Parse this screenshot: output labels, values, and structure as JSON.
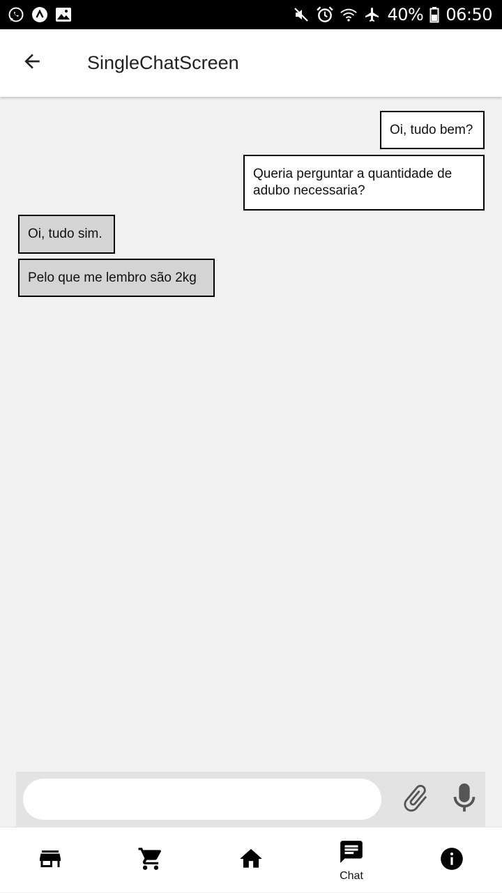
{
  "status_bar": {
    "battery": "40%",
    "time": "06:50",
    "left_icons": [
      "whatsapp-icon",
      "notification-a-icon",
      "image-icon"
    ],
    "right_icons": [
      "mute-icon",
      "alarm-icon",
      "wifi-icon",
      "airplane-icon",
      "battery-icon"
    ]
  },
  "app_bar": {
    "title": "SingleChatScreen",
    "back_icon": "arrow-left-icon"
  },
  "messages": [
    {
      "text": "Oi, tudo bem?",
      "direction": "sent"
    },
    {
      "text": "Queria perguntar a quantidade de adubo necessaria?",
      "direction": "sent"
    },
    {
      "text": "Oi, tudo sim.",
      "direction": "received"
    },
    {
      "text": "Pelo que me lembro são 2kg",
      "direction": "received"
    }
  ],
  "composer": {
    "value": "",
    "placeholder": "",
    "attach_icon": "paperclip-icon",
    "mic_icon": "microphone-icon"
  },
  "bottom_nav": {
    "items": [
      {
        "icon": "store-icon",
        "label": ""
      },
      {
        "icon": "cart-icon",
        "label": ""
      },
      {
        "icon": "home-icon",
        "label": ""
      },
      {
        "icon": "chat-icon",
        "label": "Chat",
        "active": true
      },
      {
        "icon": "info-icon",
        "label": ""
      }
    ]
  },
  "colors": {
    "background": "#f1f1f1",
    "sent_bubble": "#ffffff",
    "received_bubble": "#d4d4d4",
    "composer_bar": "#e3e3e3"
  }
}
